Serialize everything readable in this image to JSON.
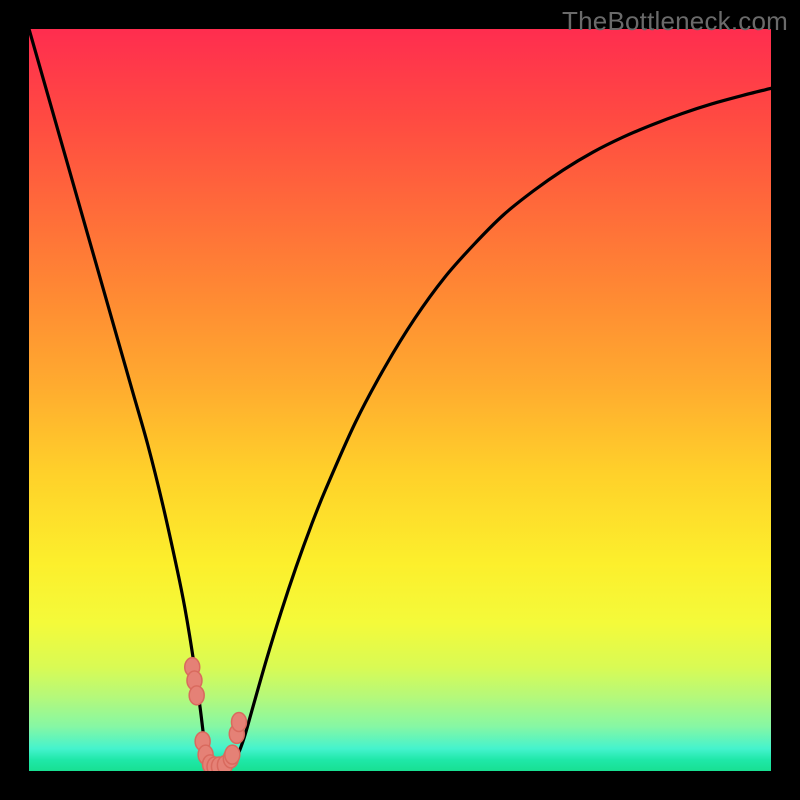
{
  "watermark": "TheBottleneck.com",
  "chart_data": {
    "type": "line",
    "title": "",
    "xlabel": "",
    "ylabel": "",
    "xlim": [
      0,
      100
    ],
    "ylim": [
      0,
      100
    ],
    "x": [
      0,
      2,
      4,
      6,
      8,
      10,
      12,
      14,
      16,
      18,
      20,
      21,
      22,
      23,
      23.5,
      24,
      24.5,
      25,
      26,
      27,
      28,
      29,
      30,
      32,
      34,
      36,
      38,
      40,
      44,
      48,
      52,
      56,
      60,
      64,
      68,
      72,
      76,
      80,
      84,
      88,
      92,
      96,
      100
    ],
    "y": [
      100,
      93,
      86,
      79,
      72,
      65,
      58,
      51,
      44,
      36,
      27,
      22,
      16,
      9,
      5,
      1.5,
      0.6,
      0.5,
      0.5,
      0.7,
      1.9,
      4.5,
      8,
      15,
      21.5,
      27.5,
      33,
      38,
      47,
      54.5,
      61,
      66.5,
      71,
      75,
      78.2,
      81,
      83.4,
      85.4,
      87.1,
      88.6,
      89.9,
      91,
      92
    ],
    "markers": {
      "x": [
        22.0,
        22.3,
        22.6,
        23.4,
        23.8,
        24.4,
        25.0,
        25.6,
        26.4,
        27.2,
        27.4,
        28.0,
        28.3
      ],
      "y": [
        14.0,
        12.2,
        10.2,
        4.0,
        2.2,
        0.9,
        0.6,
        0.6,
        0.8,
        1.7,
        2.2,
        5.0,
        6.6
      ]
    },
    "gradient_stops": [
      {
        "pos": 0,
        "color": "#ff2d4f"
      },
      {
        "pos": 50,
        "color": "#ffb92d"
      },
      {
        "pos": 75,
        "color": "#fbf22f"
      },
      {
        "pos": 100,
        "color": "#18e092"
      }
    ]
  }
}
